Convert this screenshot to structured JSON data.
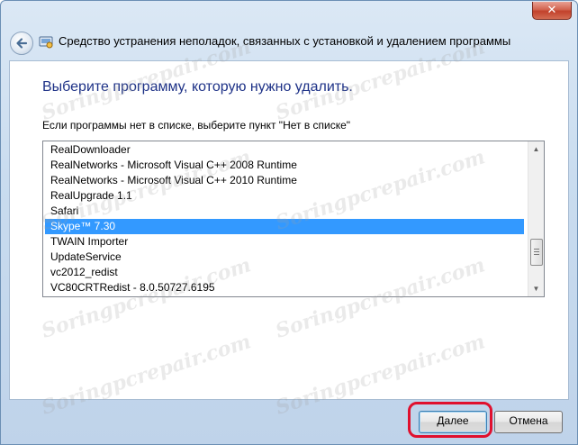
{
  "window": {
    "title": "Средство устранения неполадок, связанных с установкой и удалением программы",
    "close_glyph": "✕"
  },
  "main": {
    "heading": "Выберите программу, которую нужно удалить.",
    "instruction": "Если программы нет в списке, выберите пункт \"Нет в списке\""
  },
  "programs": [
    {
      "label": "RealDownloader"
    },
    {
      "label": "RealNetworks - Microsoft Visual C++ 2008 Runtime"
    },
    {
      "label": "RealNetworks - Microsoft Visual C++ 2010 Runtime"
    },
    {
      "label": "RealUpgrade 1.1"
    },
    {
      "label": "Safari"
    },
    {
      "label": "Skype™ 7.30"
    },
    {
      "label": "TWAIN Importer"
    },
    {
      "label": "UpdateService"
    },
    {
      "label": "vc2012_redist"
    },
    {
      "label": "VC80CRTRedist - 8.0.50727.6195"
    }
  ],
  "selected_index": 5,
  "footer": {
    "next_label": "Далее",
    "cancel_label": "Отмена"
  },
  "watermark": "Soringpcrepair.com",
  "colors": {
    "selection": "#3399ff",
    "heading": "#1e3287",
    "highlight_ring": "#e0102e"
  },
  "icons": {
    "back": "back-arrow-icon",
    "app": "troubleshooter-icon",
    "scroll_up": "scroll-up-arrow-icon",
    "scroll_down": "scroll-down-arrow-icon"
  }
}
